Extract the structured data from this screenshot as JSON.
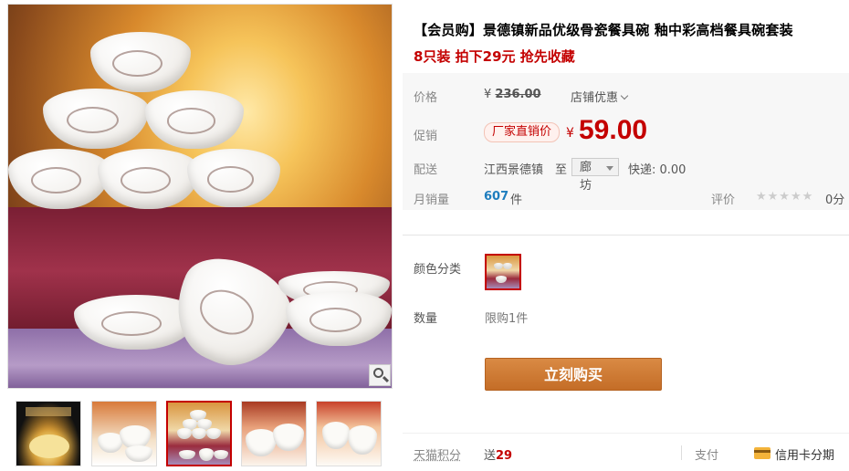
{
  "product": {
    "title": "【会员购】景德镇新品优级骨瓷餐具碗 釉中彩高档餐具碗套装",
    "subtitle": "8只装 拍下29元 抢先收藏"
  },
  "price_section": {
    "price_label": "价格",
    "currency": "¥",
    "original_price": "236.00",
    "store_promo": "店铺优惠",
    "promo_label": "促销",
    "promo_tag": "厂家直销价",
    "promo_price": "59.00",
    "shipping_label": "配送",
    "from": "江西景德镇",
    "to": "至",
    "destination": "廊坊",
    "shipping": "快递: 0.00",
    "sales_label": "月销量",
    "sales_count": "607",
    "sales_unit": "件",
    "rating_label": "评价",
    "stars": "★★★★★",
    "rating_score": "0分"
  },
  "options": {
    "color_label": "颜色分类",
    "quantity_label": "数量",
    "quantity_limit": "限购1件",
    "buy_button": "立刻购买"
  },
  "footer": {
    "points_label": "天猫积分",
    "points_text": "送",
    "points_value": "29",
    "pay_label": "支付",
    "pay_method": "信用卡分期"
  },
  "colors": {
    "accent": "#c40000",
    "buy_button": "#c46d27",
    "link": "#1e7dbe"
  }
}
